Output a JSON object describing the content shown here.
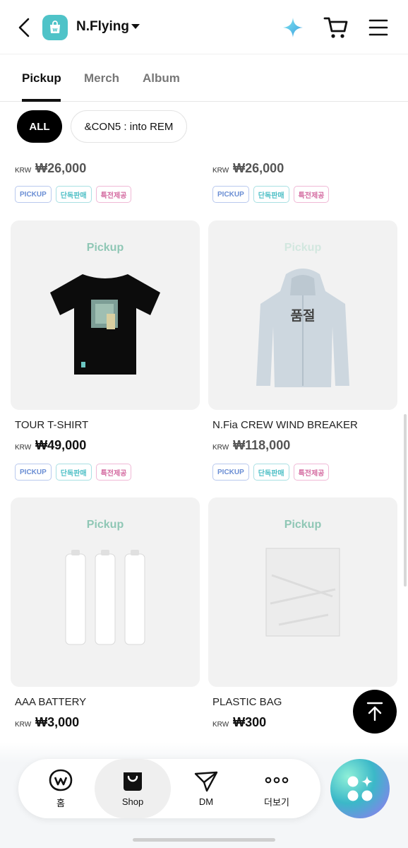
{
  "header": {
    "artist_name": "N.Flying"
  },
  "tabs": [
    {
      "label": "Pickup",
      "active": true
    },
    {
      "label": "Merch",
      "active": false
    },
    {
      "label": "Album",
      "active": false
    }
  ],
  "filters": [
    {
      "label": "ALL",
      "selected": true
    },
    {
      "label": "&CON5 : into REM",
      "selected": false
    }
  ],
  "top_row": [
    {
      "currency": "KRW",
      "price": "₩26,000",
      "badges": [
        "PICKUP",
        "단독판매",
        "특전제공"
      ]
    },
    {
      "currency": "KRW",
      "price": "₩26,000",
      "badges": [
        "PICKUP",
        "단독판매",
        "특전제공"
      ]
    }
  ],
  "products": [
    {
      "tag": "Pickup",
      "name": "TOUR T-SHIRT",
      "currency": "KRW",
      "price": "₩49,000",
      "badges": [
        "PICKUP",
        "단독판매",
        "특전제공"
      ],
      "sold_out": false
    },
    {
      "tag": "Pickup",
      "name": "N.Fia CREW WIND BREAKER",
      "currency": "KRW",
      "price": "₩118,000",
      "badges": [
        "PICKUP",
        "단독판매",
        "특전제공"
      ],
      "sold_out": true,
      "sold_out_label": "품절"
    },
    {
      "tag": "Pickup",
      "name": "AAA BATTERY",
      "currency": "KRW",
      "price": "₩3,000",
      "sold_out": false
    },
    {
      "tag": "Pickup",
      "name": "PLASTIC BAG",
      "currency": "KRW",
      "price": "₩300",
      "sold_out": false
    }
  ],
  "bottom_nav": [
    {
      "label": "홈",
      "icon": "weverse-icon",
      "active": false
    },
    {
      "label": "Shop",
      "icon": "shop-bag-icon",
      "active": true
    },
    {
      "label": "DM",
      "icon": "dm-icon",
      "active": false
    },
    {
      "label": "더보기",
      "icon": "more-dots-icon",
      "active": false
    }
  ],
  "colors": {
    "accent_teal": "#4fc3c8",
    "pickup_tag": "#8fc7b5",
    "badge_pickup": "#6a8ed4",
    "badge_exclusive": "#4dbfc6",
    "badge_bonus": "#d46aa0"
  }
}
